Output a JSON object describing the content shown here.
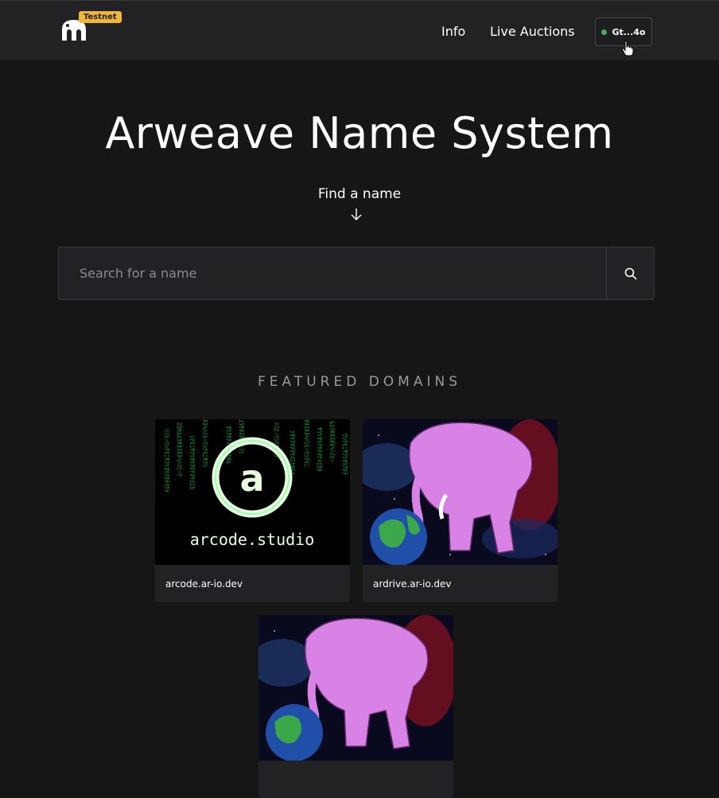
{
  "header": {
    "badge": "Testnet",
    "nav": [
      {
        "label": "Info"
      },
      {
        "label": "Live Auctions"
      }
    ],
    "wallet": {
      "label": "Gt...4o",
      "status_color": "#44af69"
    }
  },
  "hero": {
    "title": "Arweave Name System",
    "find_label": "Find a name"
  },
  "search": {
    "placeholder": "Search for a name",
    "icon": "search-icon"
  },
  "featured": {
    "heading": "FEATURED DOMAINS",
    "domains": [
      {
        "label": "arcode.ar-io.dev",
        "image_text": "arcode.studio",
        "image_letter": "a"
      },
      {
        "label": "ardrive.ar-io.dev"
      },
      {
        "label": ""
      }
    ]
  },
  "colors": {
    "badge": "#f0b63a",
    "background": "#161616",
    "header": "#222224",
    "matrix_green": "#33ff66"
  }
}
